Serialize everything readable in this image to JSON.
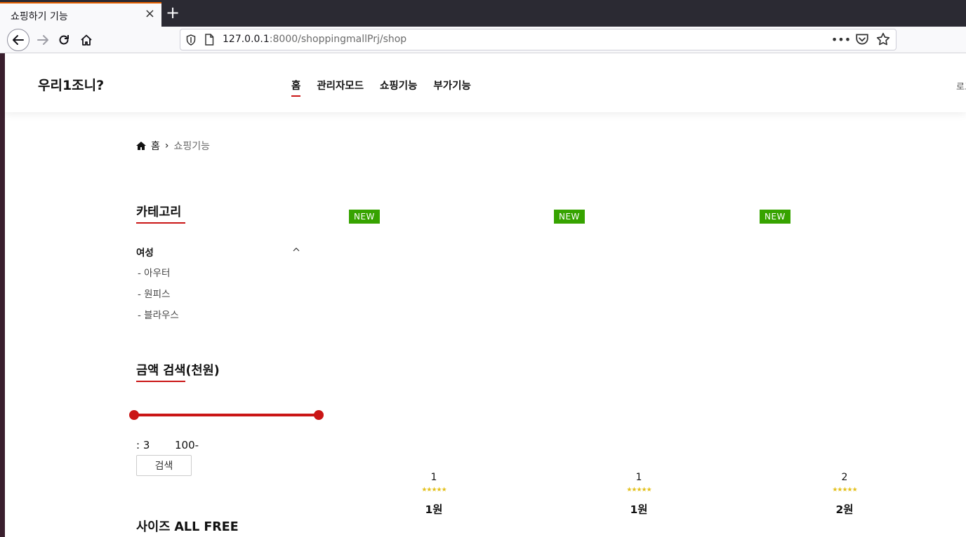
{
  "browser": {
    "tab_title": "쇼핑하기 기능",
    "url_host": "127.0.0.1",
    "url_rest": ":8000/shoppingmallPrj/shop",
    "icons": [
      "back-arrow-icon",
      "forward-arrow-icon",
      "reload-icon",
      "home-icon",
      "shield-icon",
      "page-icon",
      "more-icon",
      "pocket-icon",
      "star-icon"
    ]
  },
  "header": {
    "logo": "우리1조니?",
    "nav": [
      {
        "label": "홈",
        "active": true
      },
      {
        "label": "관리자모드",
        "active": false
      },
      {
        "label": "쇼핑기능",
        "active": false
      },
      {
        "label": "부가기능",
        "active": false
      }
    ],
    "login_label": "로그인"
  },
  "breadcrumb": {
    "home": "홈",
    "current": "쇼핑기능"
  },
  "sidebar": {
    "category_title": "카테고리",
    "group_label": "여성",
    "items": [
      "- 아우터",
      "- 원피스",
      "- 블라우스"
    ],
    "price_title": "금액 검색(천원)",
    "price_min": ": 3",
    "price_max": "100-",
    "price_range": {
      "min_fraction": 0.0,
      "max_fraction": 1.0
    },
    "search_label": "검색",
    "size_title": "사이즈 ALL FREE"
  },
  "products": [
    {
      "badge": "NEW",
      "name": "1",
      "stars": "★★★★★",
      "price": "1원"
    },
    {
      "badge": "NEW",
      "name": "1",
      "stars": "★★★★★",
      "price": "1원"
    },
    {
      "badge": "NEW",
      "name": "2",
      "stars": "★★★★★",
      "price": "2원"
    }
  ],
  "colors": {
    "accent": "#ca1515",
    "badge": "#36a300",
    "stars": "#e3c01c"
  }
}
